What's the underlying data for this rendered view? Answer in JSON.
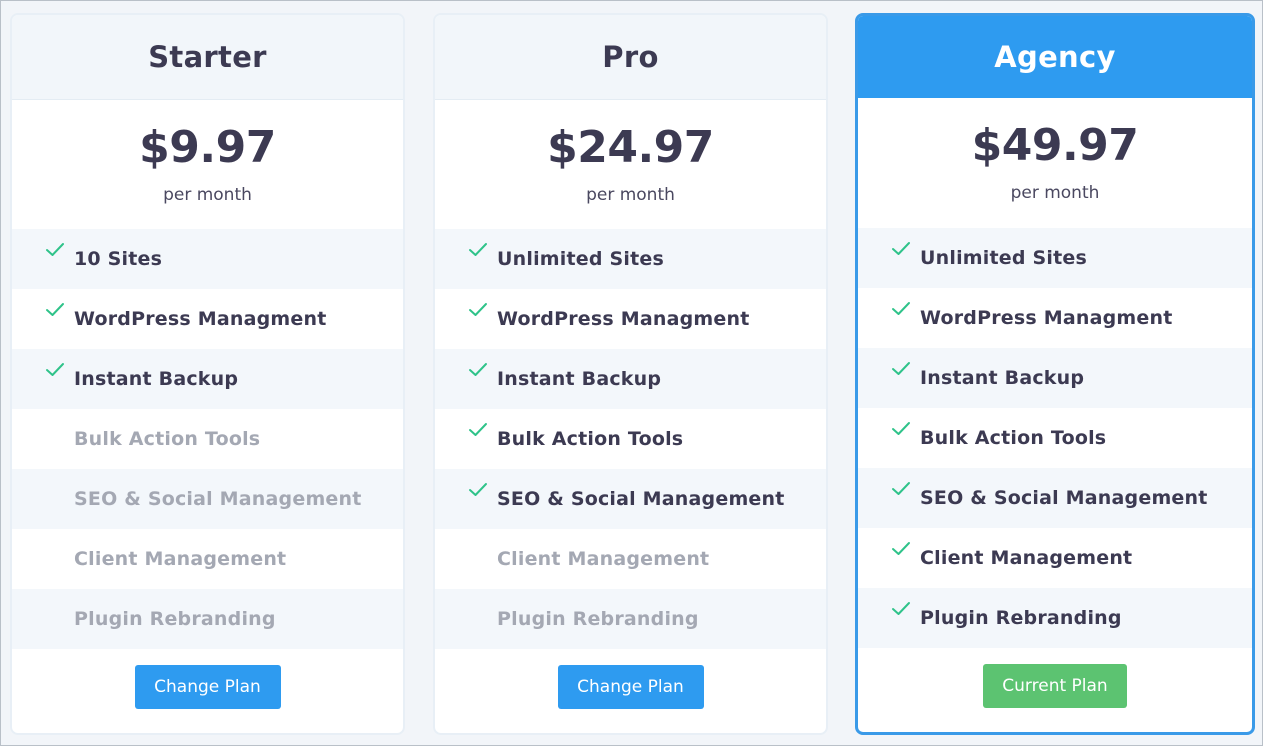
{
  "plans": [
    {
      "name": "Starter",
      "price": "$9.97",
      "period": "per month",
      "features": [
        {
          "label": "10 Sites",
          "included": true
        },
        {
          "label": "WordPress Managment",
          "included": true
        },
        {
          "label": "Instant Backup",
          "included": true
        },
        {
          "label": "Bulk Action Tools",
          "included": false
        },
        {
          "label": "SEO & Social Management",
          "included": false
        },
        {
          "label": "Client Management",
          "included": false
        },
        {
          "label": "Plugin Rebranding",
          "included": false
        }
      ],
      "button_label": "Change Plan"
    },
    {
      "name": "Pro",
      "price": "$24.97",
      "period": "per month",
      "features": [
        {
          "label": "Unlimited Sites",
          "included": true
        },
        {
          "label": "WordPress Managment",
          "included": true
        },
        {
          "label": "Instant Backup",
          "included": true
        },
        {
          "label": "Bulk Action Tools",
          "included": true
        },
        {
          "label": "SEO & Social Management",
          "included": true
        },
        {
          "label": "Client Management",
          "included": false
        },
        {
          "label": "Plugin Rebranding",
          "included": false
        }
      ],
      "button_label": "Change Plan"
    },
    {
      "name": "Agency",
      "price": "$49.97",
      "period": "per month",
      "features": [
        {
          "label": "Unlimited Sites",
          "included": true
        },
        {
          "label": "WordPress Managment",
          "included": true
        },
        {
          "label": "Instant Backup",
          "included": true
        },
        {
          "label": "Bulk Action Tools",
          "included": true
        },
        {
          "label": "SEO & Social Management",
          "included": true
        },
        {
          "label": "Client Management",
          "included": true
        },
        {
          "label": "Plugin Rebranding",
          "included": true
        }
      ],
      "button_label": "Current Plan",
      "current": true
    }
  ],
  "colors": {
    "accent": "#2e9bf0",
    "current_button": "#5cc371",
    "check": "#2fc38a",
    "text": "#3c3a52",
    "muted_text": "#a4a8b3"
  },
  "icons": {
    "check": "check-icon"
  }
}
